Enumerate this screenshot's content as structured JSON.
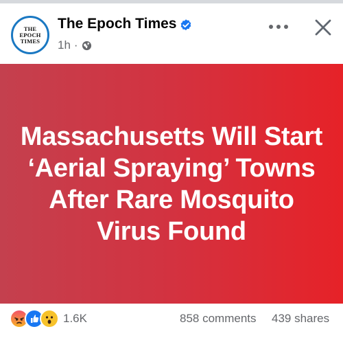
{
  "post": {
    "page_name": "The Epoch Times",
    "avatar_lines": [
      "THE",
      "EPOCH",
      "TIMES"
    ],
    "time": "1h",
    "dot": "·",
    "verified_icon": "verified-badge-icon",
    "privacy_icon": "globe-icon"
  },
  "header_actions": {
    "more_icon": "more-horizontal-icon",
    "close_icon": "close-icon"
  },
  "image": {
    "headline": "Massachusetts Will Start ‘Aerial Spraying’ Towns After Rare Mosquito Virus Found"
  },
  "engagement": {
    "reaction_icons": [
      "angry-reaction-icon",
      "like-reaction-icon",
      "wow-reaction-icon"
    ],
    "reaction_count": "1.6K",
    "comments": "858 comments",
    "shares": "439 shares"
  },
  "colors": {
    "accent_blue": "#1877f2",
    "image_gradient_start": "#c4404e",
    "image_gradient_end": "#e62228",
    "secondary_text": "#65676b"
  }
}
